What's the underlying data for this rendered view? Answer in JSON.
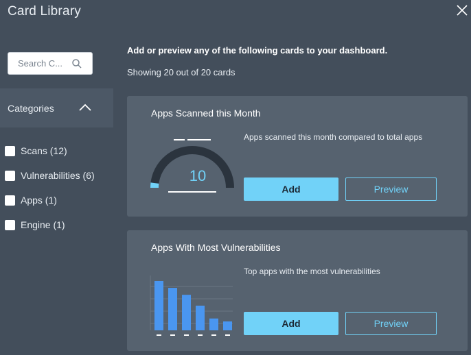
{
  "header": {
    "title": "Card Library",
    "close_icon": "close-icon"
  },
  "sidebar": {
    "search": {
      "placeholder": "Search C...",
      "value": "",
      "icon": "search-icon"
    },
    "categories": {
      "label": "Categories",
      "icon": "chevron-up-icon",
      "items": [
        {
          "label": "Scans (12)",
          "checked": false
        },
        {
          "label": "Vulnerabilities (6)",
          "checked": false
        },
        {
          "label": "Apps (1)",
          "checked": false
        },
        {
          "label": "Engine (1)",
          "checked": false
        }
      ]
    }
  },
  "main": {
    "intro": "Add or preview any of the following cards to your dashboard.",
    "count_text": "Showing 20 out of 20 cards",
    "cards": [
      {
        "title": "Apps Scanned this Month",
        "description": "Apps scanned this month compared to total apps",
        "add_label": "Add",
        "preview_label": "Preview",
        "thumbnail": {
          "type": "gauge",
          "value": "10",
          "fill_fraction": 0.04
        }
      },
      {
        "title": "Apps With Most Vulnerabilities",
        "description": "Top apps with the most vulnerabilities",
        "add_label": "Add",
        "preview_label": "Preview",
        "thumbnail": {
          "type": "bar",
          "relative_values": [
            1.0,
            0.86,
            0.72,
            0.5,
            0.24,
            0.18
          ]
        }
      }
    ]
  },
  "colors": {
    "background": "#434e5b",
    "card": "#56626f",
    "accent": "#71d2f8",
    "bar": "#4a96f0",
    "legend_orange": "#c28a3a"
  }
}
